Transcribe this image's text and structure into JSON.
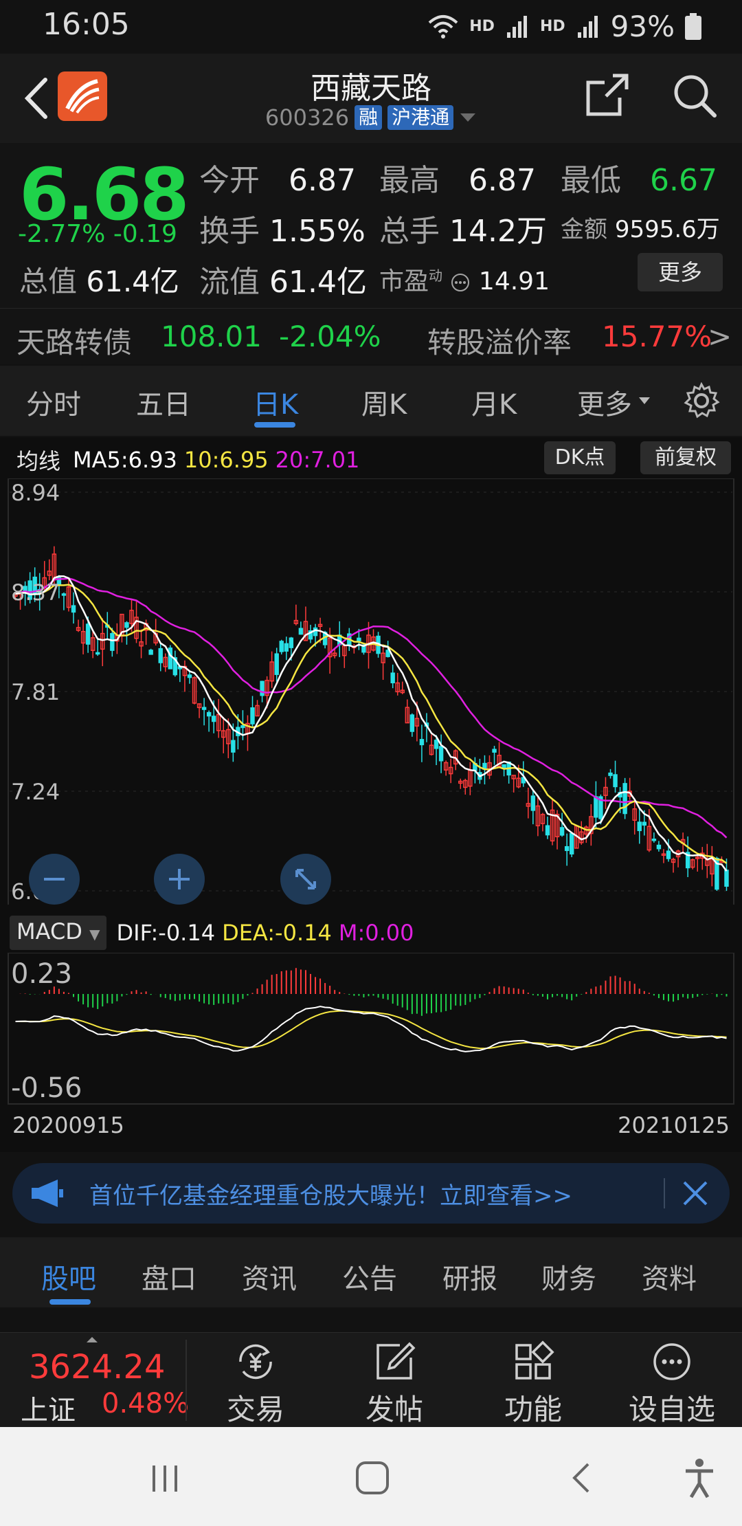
{
  "status": {
    "time": "16:05",
    "hd1": "HD",
    "hd2": "HD",
    "battery": "93%"
  },
  "header": {
    "name": "西藏天路",
    "code": "600326",
    "tag1": "融",
    "tag2": "沪港通"
  },
  "quote": {
    "price": "6.68",
    "change_pct": "-2.77%",
    "change": "-0.19",
    "mkt_cap_label": "总值",
    "mkt_cap": "61.4亿",
    "open_label": "今开",
    "open": "6.87",
    "high_label": "最高",
    "high": "6.87",
    "low_label": "最低",
    "low": "6.67",
    "turnover_label": "换手",
    "turnover": "1.55%",
    "volume_label": "总手",
    "volume": "14.2万",
    "amount_label": "金额",
    "amount": "9595.6万",
    "float_cap_label": "流值",
    "float_cap": "61.4亿",
    "pe_label": "市盈",
    "pe_sup": "动",
    "pe": "14.91",
    "more_label": "更多"
  },
  "bond": {
    "name": "天路转债",
    "price": "108.01",
    "pct": "-2.04%",
    "premium_label": "转股溢价率",
    "premium": "15.77%",
    "arrow": ">"
  },
  "ktabs": [
    "分时",
    "五日",
    "日K",
    "周K",
    "月K",
    "更多"
  ],
  "chart": {
    "ma_label": "均线",
    "ma5": "MA5:6.93",
    "ma10": "10:6.95",
    "ma20": "20:7.01",
    "dk_btn": "DK点",
    "adj_btn": "前复权",
    "y_ticks": [
      "8.94",
      "8.37",
      "7.81",
      "7.24",
      "6.67"
    ],
    "macd_select": "MACD",
    "dif": "DIF:-0.14",
    "dea": "DEA:-0.14",
    "m": "M:0.00",
    "macd_top": "0.23",
    "macd_bottom": "-0.56",
    "date_start": "20200915",
    "date_end": "20210125"
  },
  "banner": {
    "text": "首位千亿基金经理重仓股大曝光！立即查看>>"
  },
  "info_tabs": [
    "股吧",
    "盘口",
    "资讯",
    "公告",
    "研报",
    "财务",
    "资料"
  ],
  "bottom": {
    "index_value": "3624.24",
    "index_name": "上证",
    "index_pct": "0.48%",
    "nav": [
      "交易",
      "发帖",
      "功能",
      "设自选"
    ]
  },
  "colors": {
    "up": "#ff3b3b",
    "down": "#1fd24a",
    "accent": "#3b86e0",
    "ma5": "#ffffff",
    "ma10": "#f5e642",
    "ma20": "#e020e0",
    "candle_down": "#28e0e6"
  }
}
